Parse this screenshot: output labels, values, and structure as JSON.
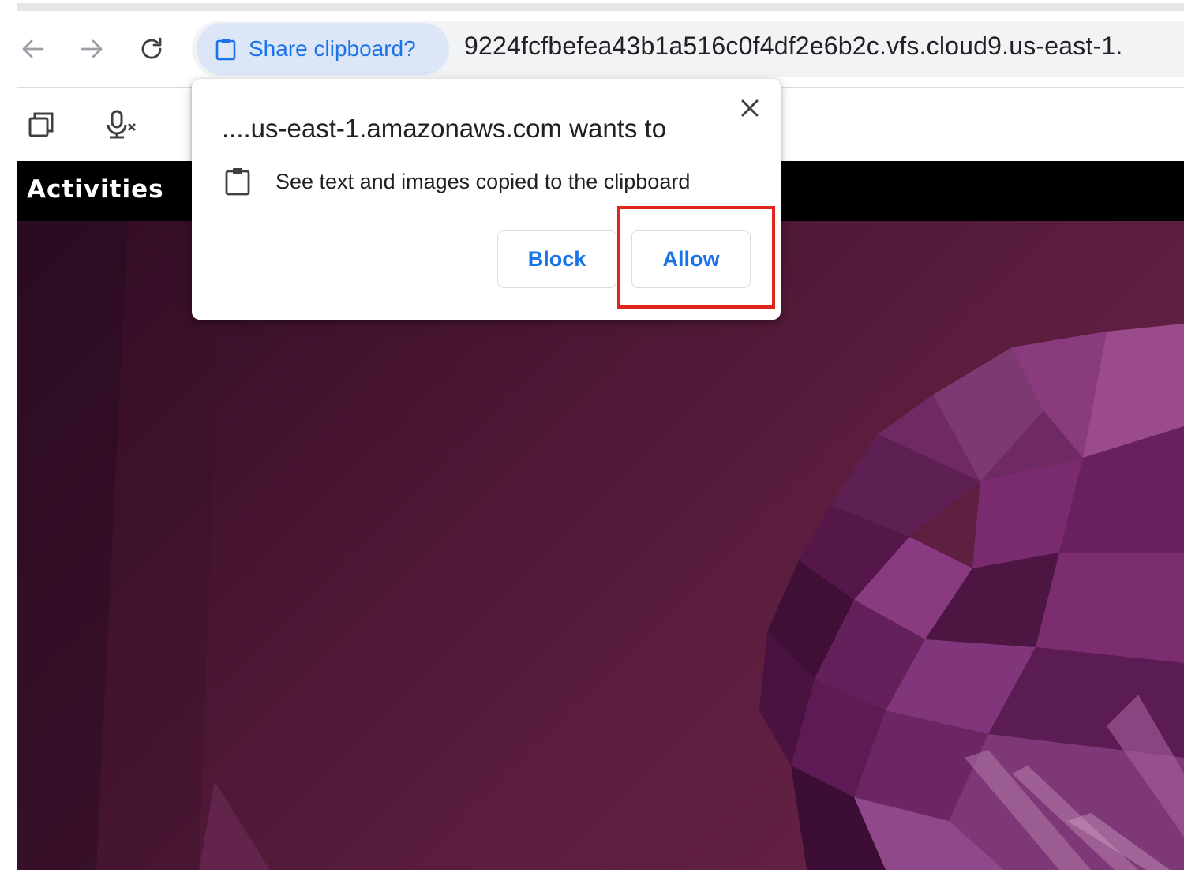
{
  "browser": {
    "address_chip_label": "Share clipboard?",
    "url": "9224fcfbefea43b1a516c0f4df2e6b2c.vfs.cloud9.us-east-1."
  },
  "desktop": {
    "activities_label": "Activities"
  },
  "permission_popup": {
    "title": "....us-east-1.amazonaws.com wants to",
    "permission_text": "See text and images copied to the clipboard",
    "block_label": "Block",
    "allow_label": "Allow"
  },
  "colors": {
    "accent_blue": "#1a73e8",
    "highlight_red": "#e0261c",
    "ubuntu_purple": "#5a1d3e"
  }
}
